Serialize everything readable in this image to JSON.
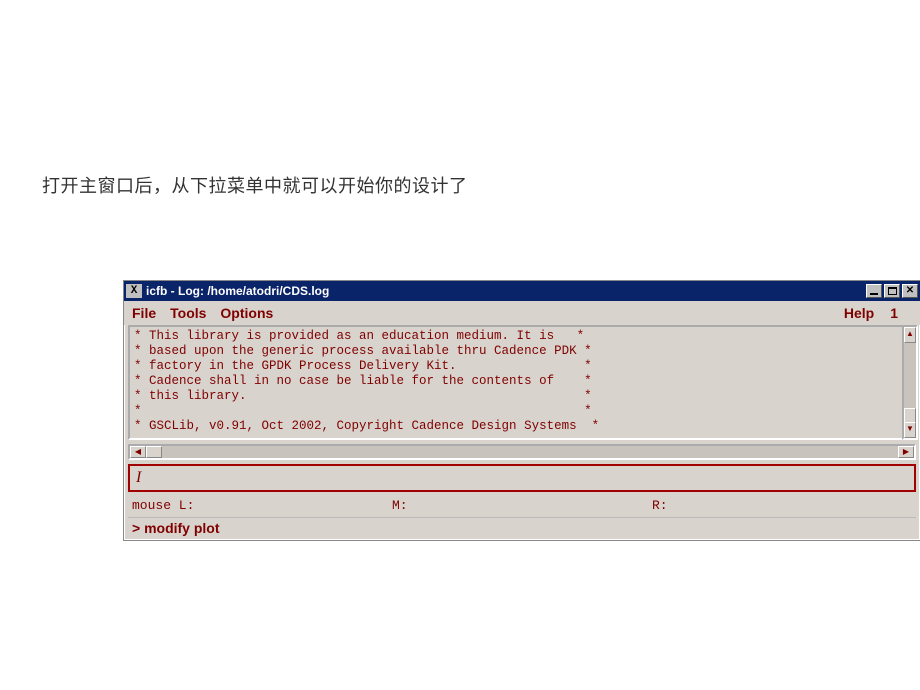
{
  "instruction": "打开主窗口后，从下拉菜单中就可以开始你的设计了",
  "window": {
    "title": "icfb - Log: /home/atodri/CDS.log",
    "menu": {
      "file": "File",
      "tools": "Tools",
      "options": "Options",
      "help": "Help",
      "counter": "1"
    },
    "log_lines": [
      "* This library is provided as an education medium. It is   *",
      "* based upon the generic process available thru Cadence PDK *",
      "* factory in the GPDK Process Delivery Kit.                 *",
      "* Cadence shall in no case be liable for the contents of    *",
      "* this library.                                             *",
      "*                                                           *",
      "* GSCLib, v0.91, Oct 2002, Copyright Cadence Design Systems  *"
    ],
    "cmdline_caret": "I",
    "mouse": {
      "l": "mouse L:",
      "m": "M:",
      "r": "R:"
    },
    "status": "> modify plot"
  }
}
